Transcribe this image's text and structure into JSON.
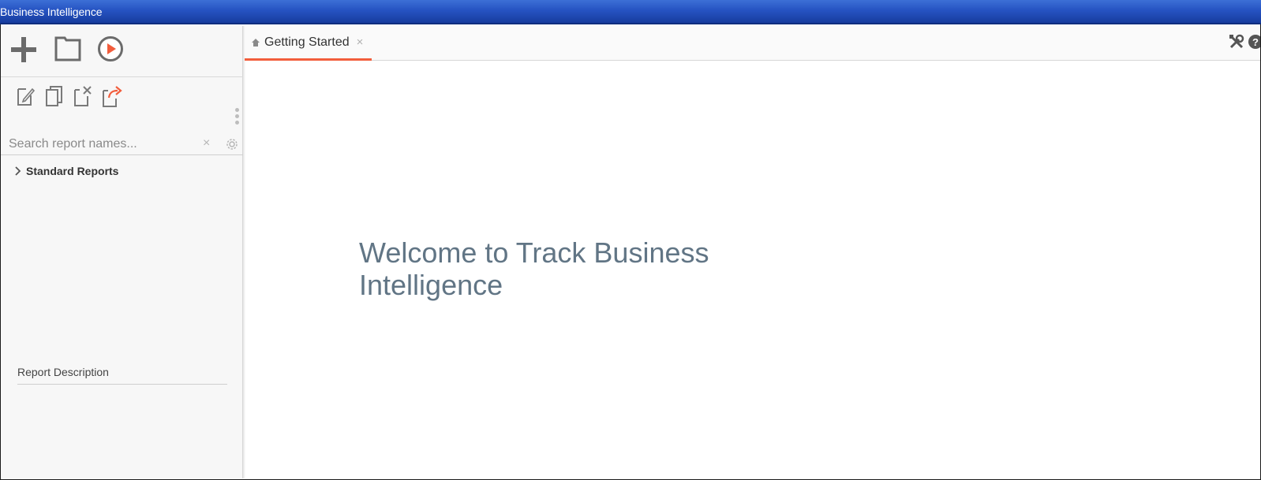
{
  "window": {
    "title": "Business Intelligence"
  },
  "toolbar": {
    "primary": [
      {
        "name": "add-icon"
      },
      {
        "name": "folder-icon"
      },
      {
        "name": "run-icon"
      }
    ],
    "secondary": [
      {
        "name": "edit-icon"
      },
      {
        "name": "copy-icon"
      },
      {
        "name": "delete-icon"
      },
      {
        "name": "share-icon"
      }
    ]
  },
  "search": {
    "placeholder": "Search report names...",
    "value": "",
    "clear_label": "×"
  },
  "tree": {
    "items": [
      {
        "label": "Standard Reports",
        "expanded": false
      }
    ]
  },
  "sidebar": {
    "report_description_label": "Report Description"
  },
  "tabs": [
    {
      "label": "Getting Started",
      "icon": "home-icon",
      "active": true,
      "close_label": "×"
    }
  ],
  "main": {
    "welcome_line1": "Welcome to Track Business",
    "welcome_line2": "Intelligence"
  },
  "colors": {
    "titlebar": "#2653c2",
    "active_tab_underline": "#f25d3c",
    "welcome_text": "#617585",
    "run_icon_accent": "#f25d3c"
  }
}
